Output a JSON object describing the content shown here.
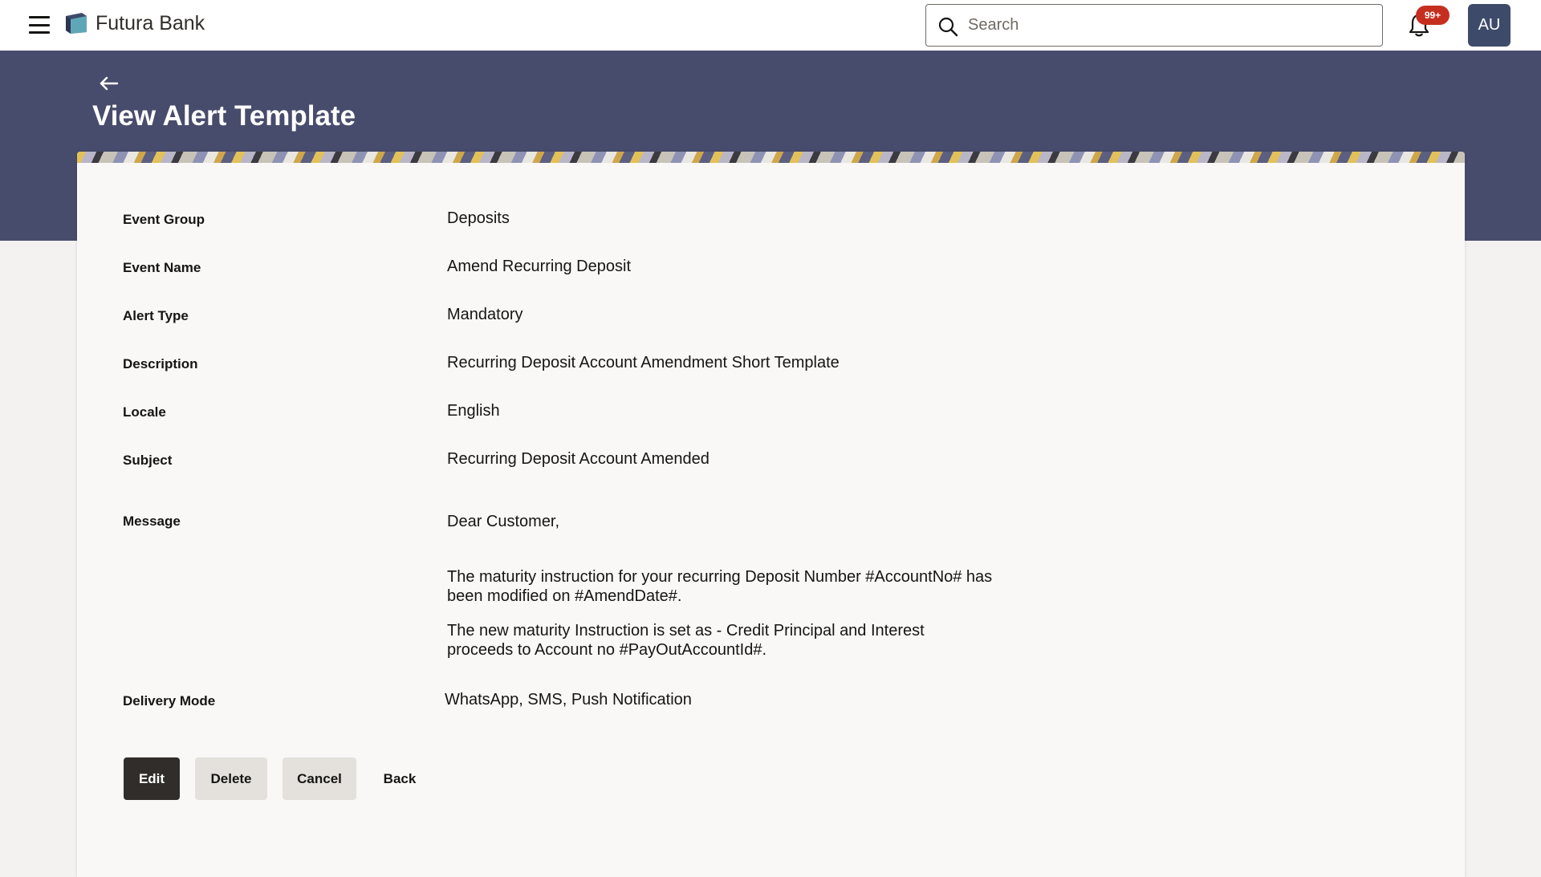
{
  "header": {
    "brand": "Futura Bank",
    "search_placeholder": "Search",
    "notification_badge": "99+",
    "avatar_initials": "AU"
  },
  "page": {
    "title": "View Alert Template"
  },
  "fields": [
    {
      "label": "Event Group",
      "value": "Deposits"
    },
    {
      "label": "Event Name",
      "value": "Amend Recurring Deposit"
    },
    {
      "label": "Alert Type",
      "value": "Mandatory"
    },
    {
      "label": "Description",
      "value": "Recurring Deposit Account Amendment Short Template"
    },
    {
      "label": "Locale",
      "value": "English"
    },
    {
      "label": "Subject",
      "value": "Recurring Deposit Account Amended"
    }
  ],
  "message": {
    "label": "Message",
    "greeting": "Dear Customer,",
    "paragraph1": "The maturity instruction for your recurring Deposit Number #AccountNo# has been modified on #AmendDate#.",
    "paragraph2": "The new maturity Instruction is set as - Credit Principal and Interest proceeds to Account no #PayOutAccountId#."
  },
  "delivery": {
    "label": "Delivery Mode",
    "value": "WhatsApp, SMS, Push Notification"
  },
  "actions": {
    "edit": "Edit",
    "delete": "Delete",
    "cancel": "Cancel",
    "back": "Back"
  },
  "colors": {
    "banner": "#484c6c",
    "primary_button": "#312d2a",
    "secondary_button": "#e4e1dd",
    "badge": "#c62f1f",
    "avatar": "#3e4a69"
  }
}
